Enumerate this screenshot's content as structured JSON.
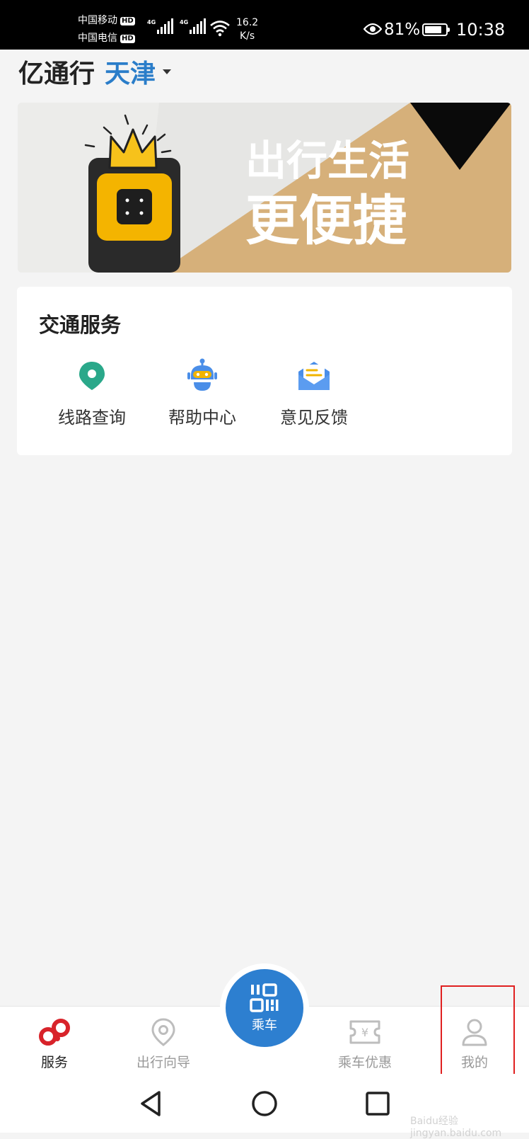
{
  "status_bar": {
    "carrier_1": "中国移动",
    "carrier_2": "中国电信",
    "hd_badge": "HD",
    "network_type": "4G",
    "speed_value": "16.2",
    "speed_unit": "K/s",
    "battery_percent": "81%",
    "battery_level": 0.81,
    "time": "10:38"
  },
  "header": {
    "app_title": "亿通行",
    "city": "天津"
  },
  "banner": {
    "line_1": "出行生活",
    "line_2": "更便捷",
    "background_color": "#d6b07a"
  },
  "traffic_services": {
    "title": "交通服务",
    "items": [
      {
        "label": "线路查询",
        "icon": "location-pin-icon",
        "color": "#2aa88a"
      },
      {
        "label": "帮助中心",
        "icon": "robot-icon",
        "color": "#4a8ee8"
      },
      {
        "label": "意见反馈",
        "icon": "envelope-icon",
        "color": "#4a8ee8"
      }
    ]
  },
  "bottom_nav": {
    "items": [
      {
        "label": "服务",
        "icon": "service-link-icon",
        "active": true
      },
      {
        "label": "出行向导",
        "icon": "location-pin-icon",
        "active": false
      },
      {
        "label": "乘车优惠",
        "icon": "ticket-yen-icon",
        "active": false
      },
      {
        "label": "我的",
        "icon": "user-profile-icon",
        "active": false
      }
    ],
    "center_button": {
      "label": "乘车",
      "icon": "qr-code-icon"
    },
    "active_color": "#d8232a",
    "accent_color": "#2d7fd0"
  },
  "system_nav": {
    "back": "triangle-back-icon",
    "home": "circle-home-icon",
    "recent": "square-recent-icon"
  },
  "watermark": "Baidu经验 jingyan.baidu.com"
}
